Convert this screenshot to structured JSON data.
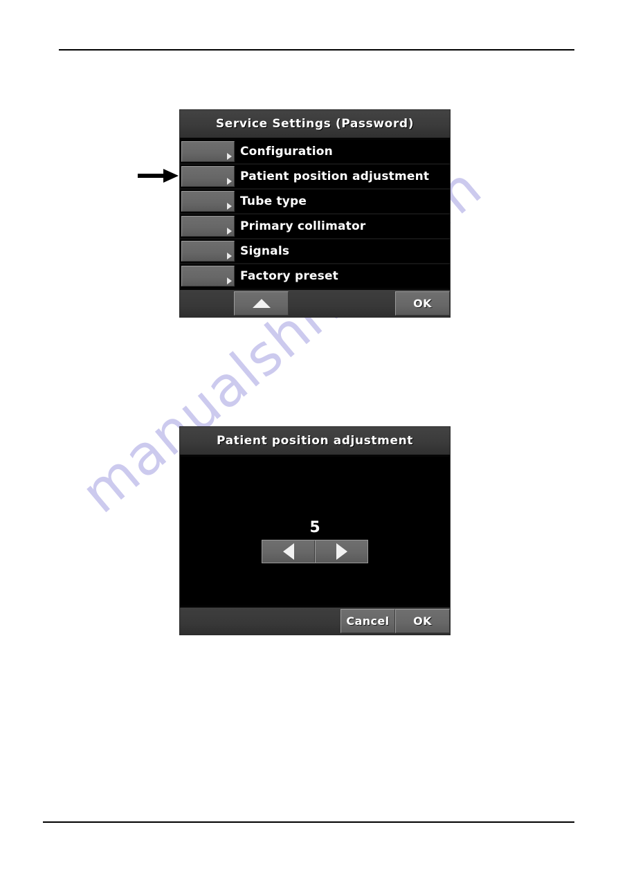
{
  "page": {
    "background_color": "#ffffff",
    "rule_color": "#000000",
    "watermark_text": "manualshive.com",
    "watermark_color": "#b9b6e8"
  },
  "annotation": {
    "pointer_arrow_name": "right-pointing-arrow",
    "pointer_arrow_color": "#000000",
    "points_to": "Patient position adjustment"
  },
  "service_settings_dialog": {
    "title": "Service Settings (Password)",
    "title_bar_color": "#3b3b3b",
    "screen_background": "#000000",
    "text_color": "#ffffff",
    "menu_items": [
      {
        "label": "Configuration",
        "caret": "chevron-right-icon"
      },
      {
        "label": "Patient position adjustment",
        "caret": "chevron-right-icon"
      },
      {
        "label": "Tube type",
        "caret": "chevron-right-icon"
      },
      {
        "label": "Primary collimator",
        "caret": "chevron-right-icon"
      },
      {
        "label": "Signals",
        "caret": "chevron-right-icon"
      },
      {
        "label": "Factory preset",
        "caret": "chevron-right-icon"
      }
    ],
    "toolbar": {
      "scroll_up_icon": "triangle-up-icon",
      "ok_label": "OK"
    }
  },
  "patient_position_dialog": {
    "title": "Patient position adjustment",
    "title_bar_color": "#3b3b3b",
    "screen_background": "#000000",
    "value": "5",
    "decrement_icon": "triangle-left-icon",
    "increment_icon": "triangle-right-icon",
    "toolbar": {
      "cancel_label": "Cancel",
      "ok_label": "OK"
    }
  }
}
